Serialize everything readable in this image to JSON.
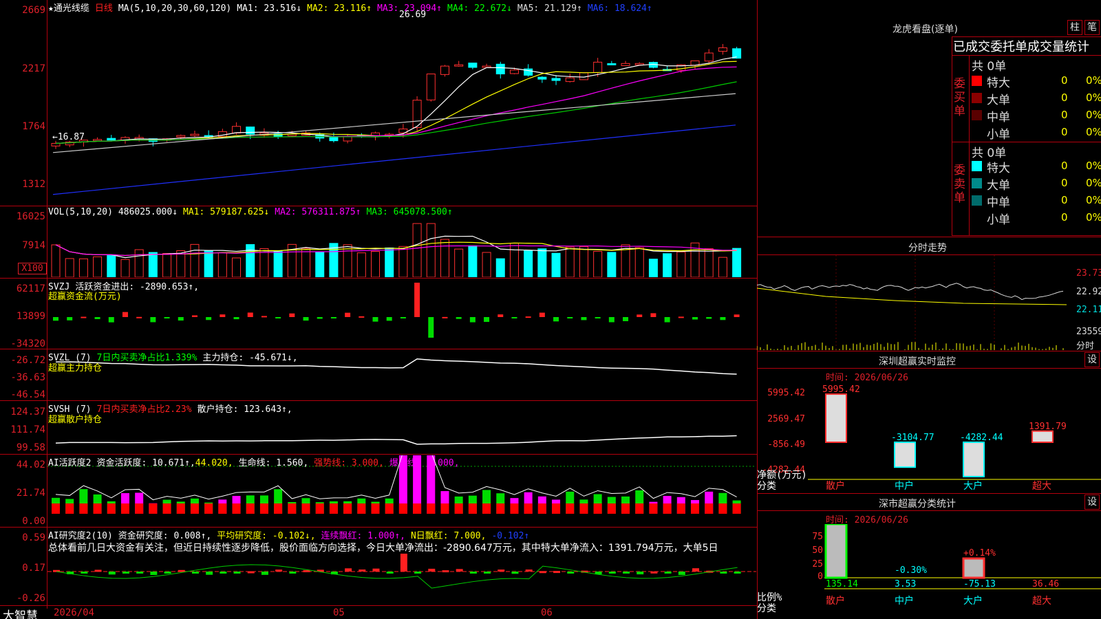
{
  "app_name": "大智慧",
  "main": {
    "star": "★",
    "stock_name": "通光线缆",
    "period": "日线",
    "ma_header": {
      "label": "MA(5,10,20,30,60,120)",
      "ma1": "MA1: 23.516↓",
      "ma2": "MA2: 23.116↑",
      "ma3": "MA3: 23.094↑",
      "ma4": "MA4: 22.672↓",
      "ma5": "MA5: 21.129↑",
      "ma6": "MA6: 18.624↑"
    },
    "price_axis": [
      "2669",
      "2217",
      "1764",
      "1312"
    ],
    "high_label": "26.69",
    "low_label": "←16.87",
    "vol_header": {
      "label": "VOL(5,10,20)",
      "value": "486025.000↓",
      "ma1": "MA1: 579187.625↓",
      "ma2": "MA2: 576311.875↑",
      "ma3": "MA3: 645078.500↑"
    },
    "vol_axis": [
      "16025",
      "7914"
    ],
    "vol_unit": "X100",
    "svzj_header": {
      "label": "SVZJ",
      "text": "活跃资金进出: -2890.653↑,",
      "sub": "超赢资金流(万元)"
    },
    "svzj_axis": [
      "62117",
      "13899",
      "-34320"
    ],
    "svzl_header": {
      "label": "SVZL (7)",
      "text1": "7日内买卖净占比1.339%",
      "text2": "主力持仓: -45.671↓,",
      "sub": "超赢主力持仓"
    },
    "svzl_axis": [
      "-26.72",
      "-36.63",
      "-46.54"
    ],
    "svsh_header": {
      "label": "SVSH (7)",
      "text1": "7日内买卖净占比2.23%",
      "text2": "散户持仓: 123.643↑,",
      "sub": "超赢散户持仓"
    },
    "svsh_axis": [
      "124.37",
      "111.74",
      "99.58"
    ],
    "ai1_header": {
      "label": "AI活跃度2",
      "t1": "资金活跃度: 10.671↑,",
      "t2": "44.020,",
      "t3": "生命线: 1.560,",
      "t4": "强势线: 3.000,",
      "t5": "爆发线: 6.000,"
    },
    "ai1_axis": [
      "44.02",
      "21.74",
      "0.00"
    ],
    "ai2_header": {
      "label": "AI研究度2(10)",
      "t1": "资金研究度: 0.008↑,",
      "t2": "平均研究度: -0.102↓,",
      "t3": "连续飘红: 1.000↑,",
      "t4": "N日飘红: 7.000,",
      "t5": "-0.102↑"
    },
    "ai2_text": "总体看前几日大资金有关注，但近日持续性逐步降低，股价面临方向选择，今日大单净流出：-2890.647万元，其中特大单净流入：1391.794万元，大单5日",
    "ai2_axis": [
      "0.59",
      "0.17",
      "-0.26"
    ],
    "date_axis": [
      "2026/04",
      "05",
      "06"
    ]
  },
  "right": {
    "lhb_title": "龙虎看盘(逐单)",
    "btn_zhu": "柱",
    "btn_bi": "笔",
    "stats_title": "已成交委托单成交量统计",
    "buy": {
      "side": "委买单",
      "total": "共 0单",
      "rows": [
        {
          "name": "特大",
          "count": "0",
          "pct": "0%",
          "color": "#ff0000"
        },
        {
          "name": "大单",
          "count": "0",
          "pct": "0%",
          "color": "#8b0000"
        },
        {
          "name": "中单",
          "count": "0",
          "pct": "0%",
          "color": "#5a0000"
        },
        {
          "name": "小单",
          "count": "0",
          "pct": "0%",
          "color": "#000000"
        }
      ]
    },
    "sell": {
      "side": "委卖单",
      "total": "共 0单",
      "rows": [
        {
          "name": "特大",
          "count": "0",
          "pct": "0%",
          "color": "#00ffff"
        },
        {
          "name": "大单",
          "count": "0",
          "pct": "0%",
          "color": "#008b8b"
        },
        {
          "name": "中单",
          "count": "0",
          "pct": "0%",
          "color": "#006b6b"
        },
        {
          "name": "小单",
          "count": "0",
          "pct": "0%",
          "color": "#000000"
        }
      ]
    },
    "intraday_title": "分时走势",
    "intraday_axis": [
      "23.73",
      "22.92",
      "22.11",
      "23559",
      "分时"
    ],
    "sz_monitor": {
      "title": "深圳超赢实时监控",
      "set": "设",
      "time": "时间: 2026/06/26",
      "axis": [
        "5995.42",
        "2569.47",
        "-856.49",
        "-4282.44"
      ],
      "ylabel": "净额(万元)",
      "xlabel": "分类",
      "categories": [
        "散户",
        "中户",
        "大户",
        "超大"
      ],
      "values": [
        "5995.42",
        "-3104.77",
        "-4282.44",
        "1391.79"
      ]
    },
    "sz_stats": {
      "title": "深市超赢分类统计",
      "set": "设",
      "time": "时间: 2026/06/26",
      "axis": [
        "75",
        "50",
        "25",
        "0"
      ],
      "ylabel": "比例%",
      "xlabel": "分类",
      "categories": [
        "散户",
        "中户",
        "大户",
        "超大"
      ],
      "bottom_values": [
        "135.14",
        "3.53",
        "-75.13",
        "36.46"
      ],
      "top_labels": [
        "-0.30%",
        "+0.14%"
      ]
    }
  },
  "chart_data": [
    {
      "type": "candlestick",
      "title": "通光线缆 日线",
      "ylim": [
        1312,
        2669
      ],
      "series_count": 50
    },
    {
      "type": "bar",
      "title": "VOL(5,10,20)",
      "ylim": [
        0,
        16025
      ]
    },
    {
      "type": "bar",
      "title": "深圳超赢实时监控",
      "categories": [
        "散户",
        "中户",
        "大户",
        "超大"
      ],
      "values": [
        5995.42,
        -3104.77,
        -4282.44,
        1391.79
      ],
      "ylabel": "净额(万元)",
      "xlabel": "分类"
    },
    {
      "type": "bar",
      "title": "深市超赢分类统计",
      "categories": [
        "散户",
        "中户",
        "大户",
        "超大"
      ],
      "values": [
        135.14,
        3.53,
        -75.13,
        36.46
      ],
      "ylabel": "比例%",
      "xlabel": "分类",
      "ylim": [
        0,
        75
      ]
    }
  ]
}
